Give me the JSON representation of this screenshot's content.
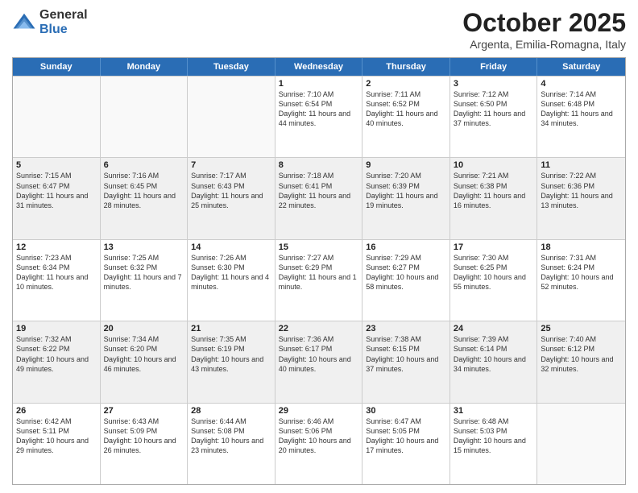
{
  "logo": {
    "general": "General",
    "blue": "Blue"
  },
  "title": "October 2025",
  "location": "Argenta, Emilia-Romagna, Italy",
  "header_days": [
    "Sunday",
    "Monday",
    "Tuesday",
    "Wednesday",
    "Thursday",
    "Friday",
    "Saturday"
  ],
  "weeks": [
    {
      "alt": false,
      "days": [
        {
          "num": "",
          "info": ""
        },
        {
          "num": "",
          "info": ""
        },
        {
          "num": "",
          "info": ""
        },
        {
          "num": "1",
          "info": "Sunrise: 7:10 AM\nSunset: 6:54 PM\nDaylight: 11 hours and 44 minutes."
        },
        {
          "num": "2",
          "info": "Sunrise: 7:11 AM\nSunset: 6:52 PM\nDaylight: 11 hours and 40 minutes."
        },
        {
          "num": "3",
          "info": "Sunrise: 7:12 AM\nSunset: 6:50 PM\nDaylight: 11 hours and 37 minutes."
        },
        {
          "num": "4",
          "info": "Sunrise: 7:14 AM\nSunset: 6:48 PM\nDaylight: 11 hours and 34 minutes."
        }
      ]
    },
    {
      "alt": true,
      "days": [
        {
          "num": "5",
          "info": "Sunrise: 7:15 AM\nSunset: 6:47 PM\nDaylight: 11 hours and 31 minutes."
        },
        {
          "num": "6",
          "info": "Sunrise: 7:16 AM\nSunset: 6:45 PM\nDaylight: 11 hours and 28 minutes."
        },
        {
          "num": "7",
          "info": "Sunrise: 7:17 AM\nSunset: 6:43 PM\nDaylight: 11 hours and 25 minutes."
        },
        {
          "num": "8",
          "info": "Sunrise: 7:18 AM\nSunset: 6:41 PM\nDaylight: 11 hours and 22 minutes."
        },
        {
          "num": "9",
          "info": "Sunrise: 7:20 AM\nSunset: 6:39 PM\nDaylight: 11 hours and 19 minutes."
        },
        {
          "num": "10",
          "info": "Sunrise: 7:21 AM\nSunset: 6:38 PM\nDaylight: 11 hours and 16 minutes."
        },
        {
          "num": "11",
          "info": "Sunrise: 7:22 AM\nSunset: 6:36 PM\nDaylight: 11 hours and 13 minutes."
        }
      ]
    },
    {
      "alt": false,
      "days": [
        {
          "num": "12",
          "info": "Sunrise: 7:23 AM\nSunset: 6:34 PM\nDaylight: 11 hours and 10 minutes."
        },
        {
          "num": "13",
          "info": "Sunrise: 7:25 AM\nSunset: 6:32 PM\nDaylight: 11 hours and 7 minutes."
        },
        {
          "num": "14",
          "info": "Sunrise: 7:26 AM\nSunset: 6:30 PM\nDaylight: 11 hours and 4 minutes."
        },
        {
          "num": "15",
          "info": "Sunrise: 7:27 AM\nSunset: 6:29 PM\nDaylight: 11 hours and 1 minute."
        },
        {
          "num": "16",
          "info": "Sunrise: 7:29 AM\nSunset: 6:27 PM\nDaylight: 10 hours and 58 minutes."
        },
        {
          "num": "17",
          "info": "Sunrise: 7:30 AM\nSunset: 6:25 PM\nDaylight: 10 hours and 55 minutes."
        },
        {
          "num": "18",
          "info": "Sunrise: 7:31 AM\nSunset: 6:24 PM\nDaylight: 10 hours and 52 minutes."
        }
      ]
    },
    {
      "alt": true,
      "days": [
        {
          "num": "19",
          "info": "Sunrise: 7:32 AM\nSunset: 6:22 PM\nDaylight: 10 hours and 49 minutes."
        },
        {
          "num": "20",
          "info": "Sunrise: 7:34 AM\nSunset: 6:20 PM\nDaylight: 10 hours and 46 minutes."
        },
        {
          "num": "21",
          "info": "Sunrise: 7:35 AM\nSunset: 6:19 PM\nDaylight: 10 hours and 43 minutes."
        },
        {
          "num": "22",
          "info": "Sunrise: 7:36 AM\nSunset: 6:17 PM\nDaylight: 10 hours and 40 minutes."
        },
        {
          "num": "23",
          "info": "Sunrise: 7:38 AM\nSunset: 6:15 PM\nDaylight: 10 hours and 37 minutes."
        },
        {
          "num": "24",
          "info": "Sunrise: 7:39 AM\nSunset: 6:14 PM\nDaylight: 10 hours and 34 minutes."
        },
        {
          "num": "25",
          "info": "Sunrise: 7:40 AM\nSunset: 6:12 PM\nDaylight: 10 hours and 32 minutes."
        }
      ]
    },
    {
      "alt": false,
      "days": [
        {
          "num": "26",
          "info": "Sunrise: 6:42 AM\nSunset: 5:11 PM\nDaylight: 10 hours and 29 minutes."
        },
        {
          "num": "27",
          "info": "Sunrise: 6:43 AM\nSunset: 5:09 PM\nDaylight: 10 hours and 26 minutes."
        },
        {
          "num": "28",
          "info": "Sunrise: 6:44 AM\nSunset: 5:08 PM\nDaylight: 10 hours and 23 minutes."
        },
        {
          "num": "29",
          "info": "Sunrise: 6:46 AM\nSunset: 5:06 PM\nDaylight: 10 hours and 20 minutes."
        },
        {
          "num": "30",
          "info": "Sunrise: 6:47 AM\nSunset: 5:05 PM\nDaylight: 10 hours and 17 minutes."
        },
        {
          "num": "31",
          "info": "Sunrise: 6:48 AM\nSunset: 5:03 PM\nDaylight: 10 hours and 15 minutes."
        },
        {
          "num": "",
          "info": ""
        }
      ]
    }
  ]
}
